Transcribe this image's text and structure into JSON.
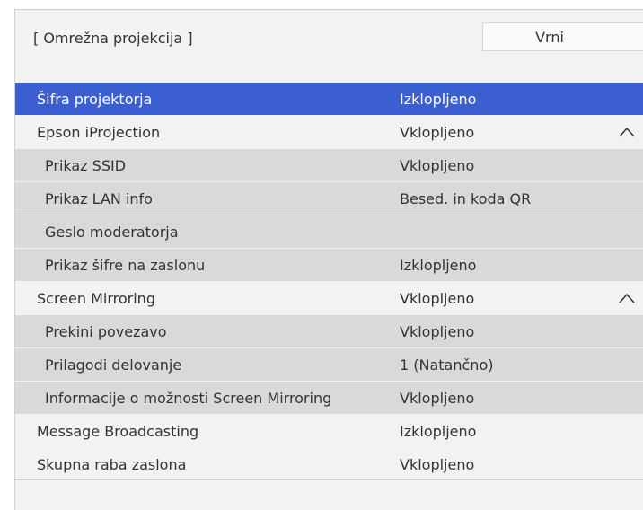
{
  "header": {
    "title": "[ Omrežna projekcija ]",
    "back_label": "Vrni"
  },
  "rows": [
    {
      "label": "Šifra projektorja",
      "value": "Izklopljeno"
    },
    {
      "label": "Epson iProjection",
      "value": "Vklopljeno",
      "icon": "chevron-up-icon"
    },
    {
      "label": "Prikaz SSID",
      "value": "Vklopljeno"
    },
    {
      "label": "Prikaz LAN info",
      "value": "Besed. in koda QR"
    },
    {
      "label": "Geslo moderatorja",
      "value": ""
    },
    {
      "label": "Prikaz šifre na zaslonu",
      "value": "Izklopljeno"
    },
    {
      "label": "Screen Mirroring",
      "value": "Vklopljeno",
      "icon": "chevron-up-icon"
    },
    {
      "label": "Prekini povezavo",
      "value": "Vklopljeno"
    },
    {
      "label": "Prilagodi delovanje",
      "value": "1 (Natančno)"
    },
    {
      "label": "Informacije o možnosti Screen Mirroring",
      "value": "Vklopljeno"
    },
    {
      "label": "Message Broadcasting",
      "value": "Izklopljeno"
    },
    {
      "label": "Skupna raba zaslona",
      "value": "Vklopljeno"
    }
  ],
  "colors": {
    "selected_bg": "#3b5fd0",
    "panel_bg": "#f2f2f2",
    "submenu_bg": "#d9d9d9"
  }
}
